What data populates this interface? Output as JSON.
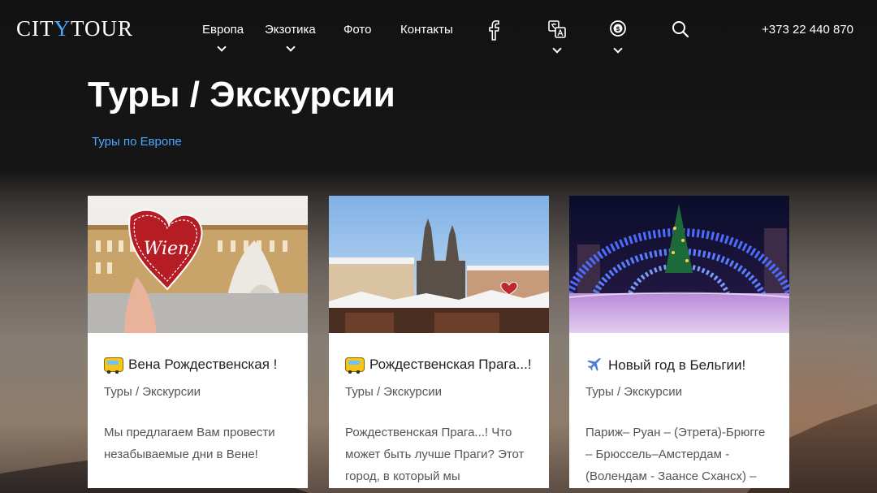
{
  "header": {
    "logo": {
      "part1": "CIT",
      "part2": "Y",
      "part3": "TOUR"
    },
    "nav": [
      {
        "label": "Европа",
        "has_submenu": true
      },
      {
        "label": "Экзотика",
        "has_submenu": true
      },
      {
        "label": "Фото",
        "has_submenu": false
      },
      {
        "label": "Контакты",
        "has_submenu": false
      }
    ],
    "icons": [
      "facebook-icon",
      "language-icon",
      "currency-icon",
      "search-icon"
    ],
    "phone": "+373 22 440 870"
  },
  "page": {
    "title": "Туры / Экскурсии",
    "breadcrumb": "Туры по Европе"
  },
  "cards": [
    {
      "icon": "bus-icon",
      "title": "Вена Рождественская !",
      "category": "Туры / Экскурсии",
      "description": "Мы предлагаем Вам провести незабываемые дни в Вене!",
      "image_label": "Wien"
    },
    {
      "icon": "bus-icon",
      "title": "Рождественская Прага...!",
      "category": "Туры / Экскурсии",
      "description": "Рождественская Прага...! Что может быть лучше Праги? Этот город, в который мы"
    },
    {
      "icon": "airplane-icon",
      "title": "Новый год в Бельгии!",
      "category": "Туры / Экскурсии",
      "description": "Париж– Руан – (Этрета)-Брюгге – Брюссель–Амстердам - (Волендам - Заансе Схансх) –"
    }
  ],
  "colors": {
    "accent": "#4aa8ff",
    "header_bg": "#161616",
    "card_bg": "#ffffff"
  }
}
